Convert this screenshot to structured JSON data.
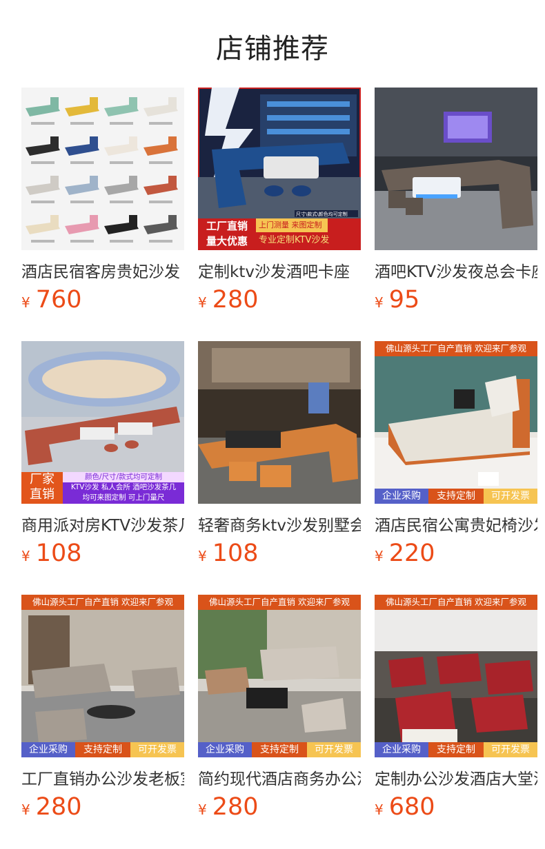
{
  "header": {
    "title": "店铺推荐"
  },
  "colors": {
    "price": "#ec4b17",
    "banner_orange": "#d9531a",
    "banner_blue": "#5560c8",
    "banner_yellow": "#f6c452"
  },
  "products": [
    {
      "name": "酒店民宿客房贵妃沙发",
      "currency": "¥",
      "price": "760",
      "image": "color-swatch-chaise-grid"
    },
    {
      "name": "定制ktv沙发酒吧卡座",
      "currency": "¥",
      "price": "280",
      "image": "blue-ktv-sofa",
      "badges": {
        "tag1": "工厂直销",
        "tag2": "量大优惠",
        "tag3": "上门测量 来图定制",
        "tag4": "专业定制KTV沙发",
        "small": "尺寸\\款式\\颜色均可定制"
      }
    },
    {
      "name": "酒吧KTV沙发夜总会卡座",
      "currency": "¥",
      "price": "95",
      "image": "grey-bar-sofa"
    },
    {
      "name": "商用派对房KTV沙发茶几",
      "currency": "¥",
      "price": "108",
      "image": "red-party-room-sofa",
      "badges": {
        "tag1": "厂家",
        "tag2": "直销",
        "line1": "颜色/尺寸/款式均可定制",
        "line2": "KTV沙发 私人会所 酒吧沙发茶几",
        "line3": "均可来图定制 可上门量尺"
      }
    },
    {
      "name": "轻奢商务ktv沙发别墅会所",
      "currency": "¥",
      "price": "108",
      "image": "orange-lounge-sofa"
    },
    {
      "name": "酒店民宿公寓贵妃椅沙发",
      "currency": "¥",
      "price": "220",
      "image": "orange-chaise-lounge",
      "top_banner": "佛山源头工厂自产直销 欢迎来厂参观",
      "bottom_banner": [
        "企业采购",
        "支持定制",
        "可开发票"
      ]
    },
    {
      "name": "工厂直销办公沙发老板室",
      "currency": "¥",
      "price": "280",
      "image": "grey-office-sofa-set",
      "top_banner": "佛山源头工厂自产直销 欢迎来厂参观",
      "bottom_banner": [
        "企业采购",
        "支持定制",
        "可开发票"
      ]
    },
    {
      "name": "简约现代酒店商务办公沙发",
      "currency": "¥",
      "price": "280",
      "image": "beige-office-sofa-set",
      "top_banner": "佛山源头工厂自产直销 欢迎来厂参观",
      "bottom_banner": [
        "企业采购",
        "支持定制",
        "可开发票"
      ]
    },
    {
      "name": "定制办公沙发酒店大堂沙发",
      "currency": "¥",
      "price": "680",
      "image": "red-armchair-factory",
      "top_banner": "佛山源头工厂自产直销 欢迎来厂参观",
      "bottom_banner": [
        "企业采购",
        "支持定制",
        "可开发票"
      ]
    }
  ]
}
